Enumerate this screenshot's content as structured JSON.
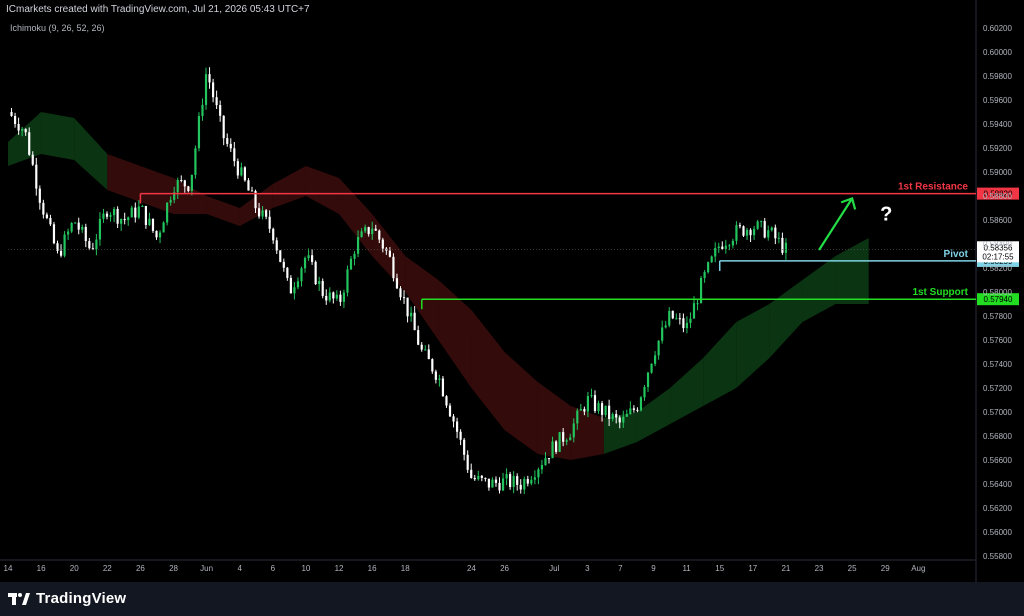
{
  "header": {
    "attribution": "ICmarkets created with TradingView.com, Jul 21, 2026 05:43 UTC+7",
    "indicator": "Ichimoku (9, 26, 52, 26)"
  },
  "footer": {
    "brand": "TradingView"
  },
  "colors": {
    "bull": "#22c55e",
    "bear": "#ffffff",
    "resistance": "#f23645",
    "pivot": "#7fd3e6",
    "support": "#22dd22",
    "cloud_bull": "#0c3a14",
    "cloud_bear": "#3a0c0c",
    "arrow": "#22dd44"
  },
  "chart_data": {
    "type": "candlestick",
    "title": "",
    "ylim": [
      0.558,
      0.6025
    ],
    "y_ticks": [
      "0.60200",
      "0.60000",
      "0.59800",
      "0.59600",
      "0.59400",
      "0.59200",
      "0.59000",
      "0.58800",
      "0.58600",
      "0.58400",
      "0.58200",
      "0.58000",
      "0.57800",
      "0.57600",
      "0.57400",
      "0.57200",
      "0.57000",
      "0.56800",
      "0.56600",
      "0.56400",
      "0.56200",
      "0.56000",
      "0.55800",
      "0.55600"
    ],
    "x_ticks": [
      "14",
      "16",
      "20",
      "22",
      "26",
      "28",
      "Jun",
      "4",
      "6",
      "10",
      "12",
      "16",
      "18",
      "24",
      "26",
      "Jul",
      "3",
      "7",
      "9",
      "11",
      "15",
      "17",
      "21",
      "23",
      "25",
      "29",
      "Aug"
    ],
    "x_tick_index": [
      0,
      2,
      4,
      6,
      8,
      10,
      12,
      14,
      16,
      18,
      20,
      22,
      24,
      28,
      30,
      33,
      35,
      37,
      39,
      41,
      43,
      45,
      47,
      49,
      51,
      53,
      55
    ],
    "close_path": [
      [
        0,
        0.595
      ],
      [
        1,
        0.5935
      ],
      [
        2,
        0.5875
      ],
      [
        3,
        0.583
      ],
      [
        4,
        0.586
      ],
      [
        5,
        0.5835
      ],
      [
        6,
        0.587
      ],
      [
        7,
        0.586
      ],
      [
        8,
        0.587
      ],
      [
        9,
        0.5845
      ],
      [
        10,
        0.589
      ],
      [
        11,
        0.589
      ],
      [
        12,
        0.5985
      ],
      [
        13,
        0.593
      ],
      [
        14,
        0.59
      ],
      [
        15,
        0.587
      ],
      [
        16,
        0.585
      ],
      [
        17,
        0.58
      ],
      [
        18,
        0.583
      ],
      [
        19,
        0.58
      ],
      [
        20,
        0.579
      ],
      [
        21,
        0.584
      ],
      [
        22,
        0.5855
      ],
      [
        23,
        0.583
      ],
      [
        24,
        0.579
      ],
      [
        25,
        0.575
      ],
      [
        26,
        0.573
      ],
      [
        27,
        0.569
      ],
      [
        28,
        0.5645
      ],
      [
        29,
        0.564
      ],
      [
        30,
        0.5642
      ],
      [
        31,
        0.564
      ],
      [
        32,
        0.5655
      ],
      [
        33,
        0.5672
      ],
      [
        34,
        0.5685
      ],
      [
        35,
        0.571
      ],
      [
        36,
        0.57
      ],
      [
        37,
        0.569
      ],
      [
        38,
        0.5705
      ],
      [
        39,
        0.575
      ],
      [
        40,
        0.578
      ],
      [
        41,
        0.577
      ],
      [
        42,
        0.581
      ],
      [
        43,
        0.584
      ],
      [
        44,
        0.585
      ],
      [
        45,
        0.5855
      ],
      [
        46,
        0.585
      ],
      [
        47,
        0.5835
      ]
    ],
    "levels": [
      {
        "name": "1st Resistance",
        "value": 0.5882,
        "label": "0.58820",
        "start_index": 8,
        "color": "resistance"
      },
      {
        "name": "Pivot",
        "value": 0.58259,
        "label": "0.58259",
        "start_index": 43,
        "color": "pivot"
      },
      {
        "name": "1st Support",
        "value": 0.5794,
        "label": "0.57940",
        "start_index": 25,
        "color": "support"
      }
    ],
    "last_price": {
      "value": 0.58356,
      "label": "0.58356",
      "countdown": "02:17:55"
    },
    "annotations": {
      "question_mark": "?",
      "arrow_from": [
        49,
        0.5835
      ],
      "arrow_to": [
        51,
        0.5878
      ]
    },
    "ichimoku_cloud": {
      "x": [
        0,
        2,
        4,
        6,
        8,
        10,
        12,
        14,
        16,
        18,
        20,
        22,
        24,
        26,
        28,
        30,
        32,
        34,
        36,
        38,
        40,
        42,
        44,
        46,
        48,
        50,
        52
      ],
      "upper": [
        0.5925,
        0.595,
        0.5945,
        0.5915,
        0.5905,
        0.5895,
        0.588,
        0.587,
        0.589,
        0.5905,
        0.5895,
        0.5865,
        0.583,
        0.581,
        0.5785,
        0.575,
        0.5725,
        0.5705,
        0.5695,
        0.57,
        0.572,
        0.5745,
        0.5775,
        0.579,
        0.581,
        0.583,
        0.5845
      ],
      "lower": [
        0.5905,
        0.5915,
        0.591,
        0.5885,
        0.5875,
        0.5865,
        0.5865,
        0.5855,
        0.587,
        0.588,
        0.5865,
        0.583,
        0.58,
        0.576,
        0.572,
        0.5685,
        0.5665,
        0.566,
        0.5665,
        0.5675,
        0.569,
        0.5705,
        0.572,
        0.5745,
        0.5775,
        0.579,
        0.579
      ]
    }
  }
}
